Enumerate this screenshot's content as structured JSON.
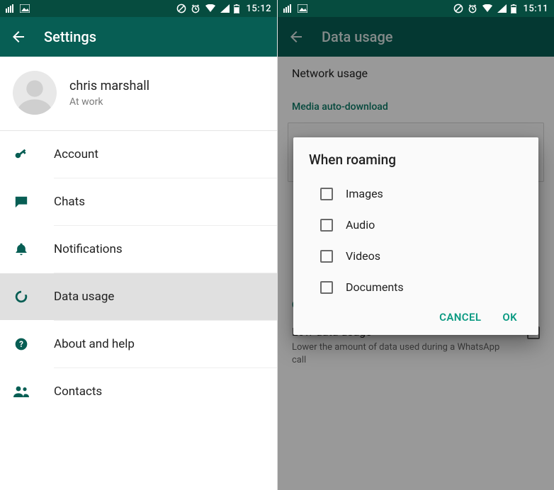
{
  "accent": "#075e54",
  "accent_light": "#0b9a82",
  "left": {
    "statusbar": {
      "time": "15:12"
    },
    "appbar": {
      "title": "Settings"
    },
    "profile": {
      "name": "chris marshall",
      "status": "At work"
    },
    "items": [
      {
        "icon": "key-icon",
        "label": "Account",
        "selected": false
      },
      {
        "icon": "chat-icon",
        "label": "Chats",
        "selected": false
      },
      {
        "icon": "bell-icon",
        "label": "Notifications",
        "selected": false
      },
      {
        "icon": "data-icon",
        "label": "Data usage",
        "selected": true
      },
      {
        "icon": "help-icon",
        "label": "About and help",
        "selected": false
      },
      {
        "icon": "contacts-icon",
        "label": "Contacts",
        "selected": false
      }
    ]
  },
  "right": {
    "statusbar": {
      "time": "15:11"
    },
    "appbar": {
      "title": "Data usage"
    },
    "network_usage_label": "Network usage",
    "media_section_label": "Media auto-download",
    "call_section_label": "Call settings",
    "low_data": {
      "title": "Low data usage",
      "subtitle": "Lower the amount of data used during a WhatsApp call",
      "checked": false
    },
    "dialog": {
      "title": "When roaming",
      "options": [
        {
          "label": "Images",
          "checked": false
        },
        {
          "label": "Audio",
          "checked": false
        },
        {
          "label": "Videos",
          "checked": false
        },
        {
          "label": "Documents",
          "checked": false
        }
      ],
      "cancel": "CANCEL",
      "ok": "OK"
    }
  }
}
